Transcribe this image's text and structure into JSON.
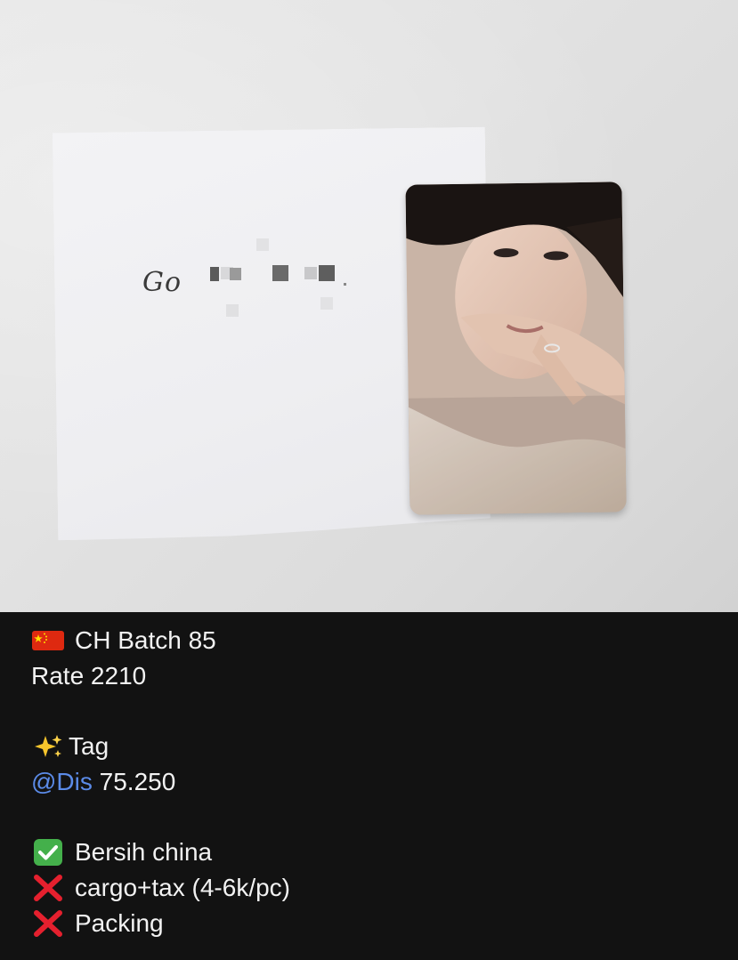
{
  "photo": {
    "alt": "Photocard next to a handwritten note",
    "handwriting": "Go"
  },
  "caption": {
    "batch": "CH Batch 85",
    "rate": "Rate 2210",
    "tag_label": "Tag",
    "mention": "@Dis",
    "mention_value": "75.250",
    "bersih": "Bersih china",
    "cargo": "cargo+tax (4-6k/pc)",
    "packing": "Packing"
  },
  "icons": {
    "flag": "china-flag-icon",
    "sparkles": "sparkles-icon",
    "check": "check-mark-button-icon",
    "cross": "cross-mark-icon"
  },
  "colors": {
    "background": "#121212",
    "text": "#f2f2f2",
    "mention": "#5b8be8",
    "check_green": "#44b04b",
    "cross_red": "#e5202e"
  }
}
